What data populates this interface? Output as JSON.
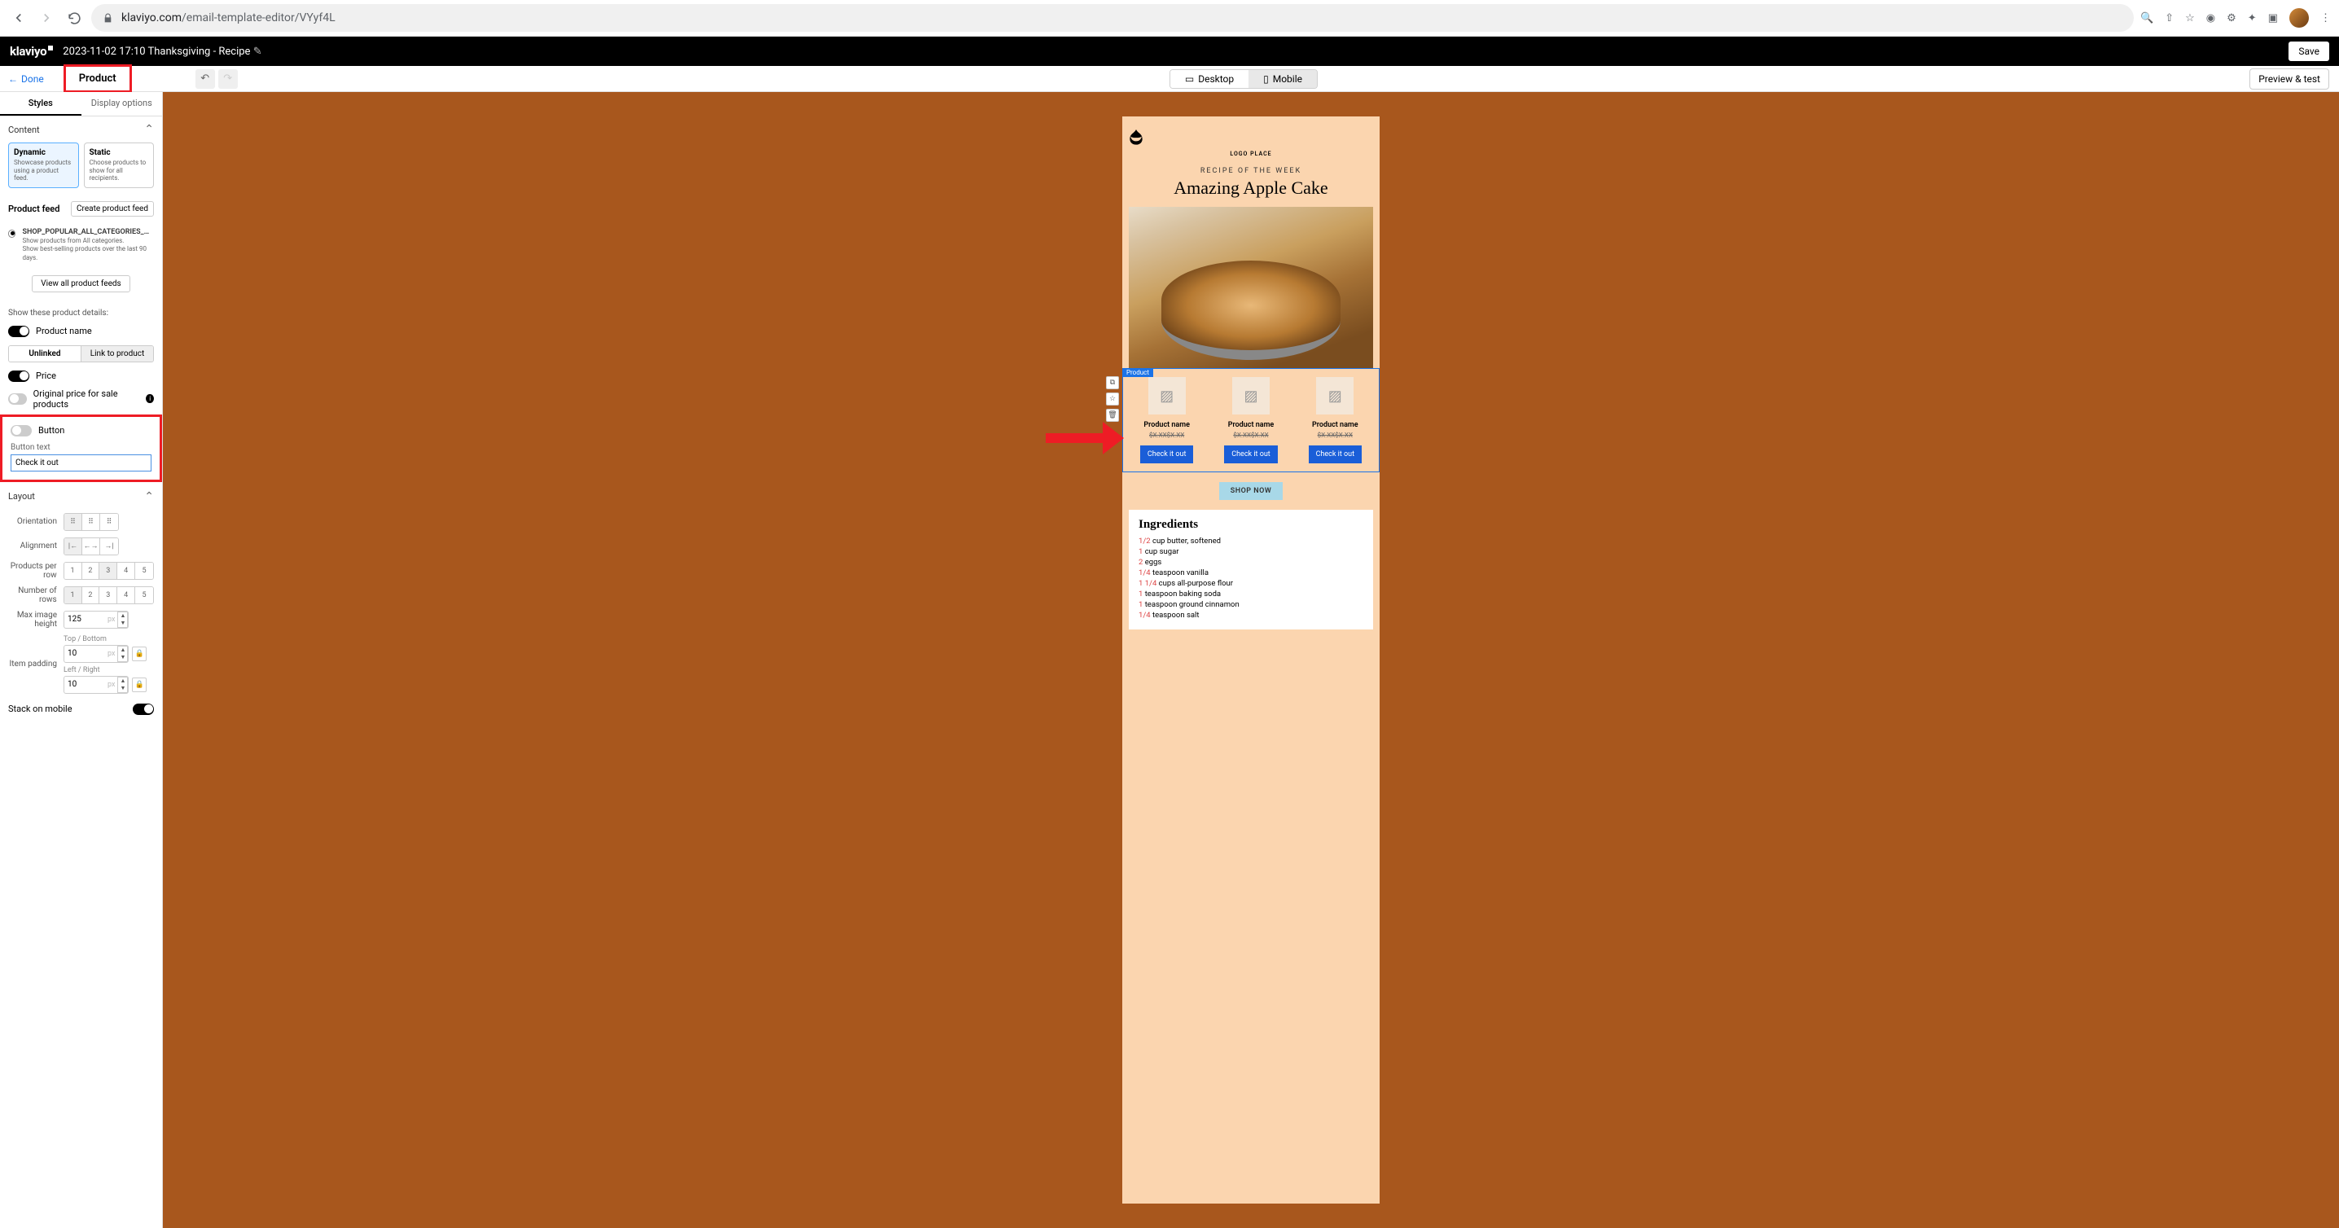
{
  "browser": {
    "url_domain": "klaviyo.com",
    "url_path": "/email-template-editor/VYyf4L"
  },
  "app_bar": {
    "brand": "klaviyo",
    "title": "2023-11-02 17:10 Thanksgiving - Recipe",
    "save_label": "Save"
  },
  "sec_bar": {
    "done_label": "Done",
    "tab_label": "Product",
    "desktop_label": "Desktop",
    "mobile_label": "Mobile",
    "preview_label": "Preview & test"
  },
  "sidebar": {
    "tabs": {
      "styles": "Styles",
      "display": "Display options"
    },
    "sections": {
      "content": {
        "title": "Content",
        "cards": [
          {
            "title": "Dynamic",
            "sub": "Showcase products using a product feed."
          },
          {
            "title": "Static",
            "sub": "Choose products to show for all recipients."
          }
        ]
      },
      "product_feed": {
        "title": "Product feed",
        "create_btn": "Create product feed",
        "feed_name": "SHOP_POPULAR_ALL_CATEGORIES_UNPER...",
        "feed_sub1": "Show products from All categories.",
        "feed_sub2": "Show best-selling products over the last 90 days.",
        "view_all": "View all product feeds"
      },
      "details": {
        "label": "Show these product details:",
        "product_name": "Product name",
        "link_unlinked": "Unlinked",
        "link_to_product": "Link to product",
        "price": "Price",
        "orig_price": "Original price for sale products",
        "button": "Button",
        "button_text_label": "Button text",
        "button_text_value": "Check it out"
      },
      "layout": {
        "title": "Layout",
        "orientation": "Orientation",
        "alignment": "Alignment",
        "products_per_row": "Products per row",
        "number_of_rows": "Number of rows",
        "max_image_height": "Max image height",
        "max_image_height_val": "125",
        "item_padding": "Item padding",
        "top_bottom": "Top / Bottom",
        "tb_val": "10",
        "left_right": "Left / Right",
        "lr_val": "10",
        "stack_mobile": "Stack on mobile",
        "unit": "px",
        "row_options": [
          "1",
          "2",
          "3",
          "4",
          "5"
        ]
      }
    }
  },
  "email": {
    "logo_caption": "LOGO PLACE",
    "kicker": "RECIPE OF THE WEEK",
    "headline": "Amazing Apple Cake",
    "product_tag": "Product",
    "product_name": "Product name",
    "product_price": "$X.XX$X.XX",
    "product_button": "Check it out",
    "shop_now": "SHOP NOW",
    "ingredients_title": "Ingredients",
    "ingredients": [
      {
        "qty": "1/2",
        "rest": " cup butter, softened"
      },
      {
        "qty": "1",
        "rest": " cup sugar"
      },
      {
        "qty": "2",
        "rest": " eggs"
      },
      {
        "qty": "1/4",
        "rest": " teaspoon vanilla"
      },
      {
        "qty": "1 1/4",
        "rest": " cups all-purpose flour"
      },
      {
        "qty": "1",
        "rest": " teaspoon baking soda"
      },
      {
        "qty": "1",
        "rest": " teaspoon ground cinnamon"
      },
      {
        "qty": "1/4",
        "rest": " teaspoon salt"
      }
    ]
  }
}
